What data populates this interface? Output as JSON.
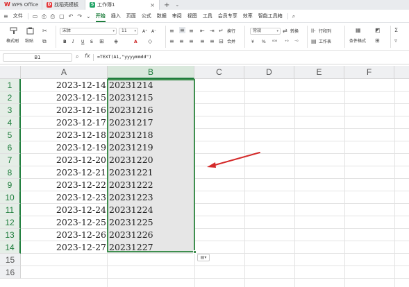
{
  "tabs": [
    {
      "label": "WPS Office",
      "icon": "wps-logo-icon"
    },
    {
      "label": "找稻壳模板",
      "icon": "docer-icon"
    },
    {
      "label": "工作簿1",
      "icon": "spreadsheet-icon"
    }
  ],
  "tab_close": "×",
  "tab_add": "+",
  "tab_more": "⌄",
  "menu": {
    "file": "文件",
    "items": [
      "开始",
      "插入",
      "页面",
      "公式",
      "数据",
      "审阅",
      "视图",
      "工具",
      "会员专享",
      "效率",
      "智能工具箱"
    ],
    "active": "开始"
  },
  "ribbon": {
    "format_painter": "格式刷",
    "paste": "粘贴",
    "font_name": "宋体",
    "font_size": "11",
    "bold": "B",
    "italic": "I",
    "underline": "U",
    "wrap": "换行",
    "merge": "合并",
    "number_format": "常规",
    "convert": "转换",
    "row_col": "行和列",
    "worksheet": "工作表",
    "cond_format": "条件格式",
    "accent_color": "#1e7d3c"
  },
  "formula_bar": {
    "cell_ref": "B1",
    "fx": "fx",
    "formula": "=TEXT(A1,\"yyyymmdd\")"
  },
  "columns": [
    "A",
    "B",
    "C",
    "D",
    "E",
    "F"
  ],
  "rows": [
    {
      "n": "1",
      "a": "2023-12-14",
      "b": "20231214"
    },
    {
      "n": "2",
      "a": "2023-12-15",
      "b": "20231215"
    },
    {
      "n": "3",
      "a": "2023-12-16",
      "b": "20231216"
    },
    {
      "n": "4",
      "a": "2023-12-17",
      "b": "20231217"
    },
    {
      "n": "5",
      "a": "2023-12-18",
      "b": "20231218"
    },
    {
      "n": "6",
      "a": "2023-12-19",
      "b": "20231219"
    },
    {
      "n": "7",
      "a": "2023-12-20",
      "b": "20231220"
    },
    {
      "n": "8",
      "a": "2023-12-21",
      "b": "20231221"
    },
    {
      "n": "9",
      "a": "2023-12-22",
      "b": "20231222"
    },
    {
      "n": "10",
      "a": "2023-12-23",
      "b": "20231223"
    },
    {
      "n": "11",
      "a": "2023-12-24",
      "b": "20231224"
    },
    {
      "n": "12",
      "a": "2023-12-25",
      "b": "20231225"
    },
    {
      "n": "13",
      "a": "2023-12-26",
      "b": "20231226"
    },
    {
      "n": "14",
      "a": "2023-12-27",
      "b": "20231227"
    },
    {
      "n": "15",
      "a": "",
      "b": ""
    },
    {
      "n": "16",
      "a": "",
      "b": ""
    }
  ],
  "selection": {
    "column": "B",
    "rows": "1-14",
    "color": "#3f8f4f"
  },
  "annotation_arrow": {
    "color": "#d42a2a"
  }
}
